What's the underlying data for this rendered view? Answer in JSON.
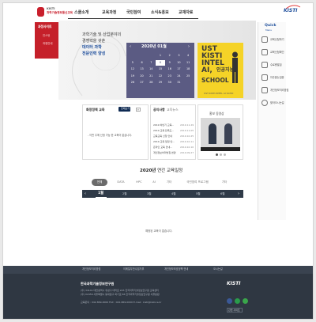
{
  "header": {
    "logo_line1": "KISTI",
    "logo_line2": "과학기술정보통신교육",
    "nav": [
      "스쿨소개",
      "교육과정",
      "국민참여",
      "소식&홍보",
      "교재자료"
    ],
    "brand": "KISTI"
  },
  "sidebar": {
    "head": "과정사이트",
    "items": [
      "인스턴",
      "과정안내"
    ]
  },
  "hero": {
    "lines": [
      "과학기술 및 산업분야의",
      "경쟁력을 갖춘",
      "데이터 과학",
      "전문인력 양성"
    ]
  },
  "calendar": {
    "title": "2020년 01월",
    "prev": "‹",
    "next": "›",
    "days": [
      "",
      "",
      "",
      "1",
      "2",
      "3",
      "4",
      "5",
      "6",
      "7",
      "8",
      "9",
      "10",
      "11",
      "12",
      "13",
      "14",
      "15",
      "16",
      "17",
      "18",
      "19",
      "20",
      "21",
      "22",
      "23",
      "24",
      "25",
      "26",
      "27",
      "28",
      "29",
      "30",
      "31",
      ""
    ],
    "highlight": "8"
  },
  "poster": {
    "lines": [
      "UST",
      "KISTI",
      "INTEL",
      "AI,"
    ],
    "word_ko": "인공지능",
    "word_school": "SCHOOL",
    "caption": "UST·KISTI·INTEL AI SCHO"
  },
  "quick": {
    "title": "Quick",
    "subtitle": "Menu",
    "items": [
      "교육신청하기",
      "교육신청확인",
      "수료증발급",
      "자주묻는질문",
      "개인정보처리방침",
      "찾아오시는길"
    ]
  },
  "edu_box": {
    "title": "화정정책 교육",
    "tag": "전체보기",
    "more": "+",
    "empty": "- 이번 주에 신청 가능 한 교육이 없습니다."
  },
  "notice_box": {
    "title": "공지사항",
    "subtitle": "교육뉴스",
    "items": [
      {
        "text": "2019 하반기 교육...",
        "date": "2019.11.29"
      },
      {
        "text": "2019 교육 만족도...",
        "date": "2019.11.05"
      },
      {
        "text": "교육교육 신청 안내",
        "date": "2019.10.25"
      },
      {
        "text": "2019 교육 일정 안...",
        "date": "2019.10.11"
      },
      {
        "text": "온라인 교육 안내...",
        "date": "2019.10.10"
      },
      {
        "text": "개인정보처리방침 변경",
        "date": "2019.09.27"
      }
    ]
  },
  "video_box": {
    "title": "홍보 동영상"
  },
  "annual": {
    "title_bold": "2020년",
    "title_rest": " 연간 교육일정",
    "categories": [
      "전체",
      "DATA",
      "HPC",
      "AI",
      "기타",
      "국민참여 프로그램",
      "기타"
    ],
    "months": [
      "1월",
      "2월",
      "3월",
      "4월",
      "5월",
      "6월"
    ],
    "prev": "‹",
    "next": "›",
    "empty": "예정된 교육이 없습니다."
  },
  "footer": {
    "links": [
      "개인정보처리방침",
      "이메일무단수집거부",
      "개인정보보호정책 안내",
      "오시는길"
    ],
    "name": "한국과학기술정보연구원",
    "address1": "(우) 34141 대전광역시 유성구 대학로 245 한국과학기술정보연구원 교육센터",
    "address2": "(우) 02456 서울특별시 동대문구 회기로 66 한국과학기술정보연구원 서울분원",
    "contact": "교육문의 : 042-869-0000   FAX : 042-869-0000   E-mail : kisti@kisti.re.kr",
    "brand": "KISTI",
    "select": "관련 사이트",
    "sns_colors": [
      "#3b5998",
      "#2a9c4b",
      "#3aa64b"
    ]
  }
}
